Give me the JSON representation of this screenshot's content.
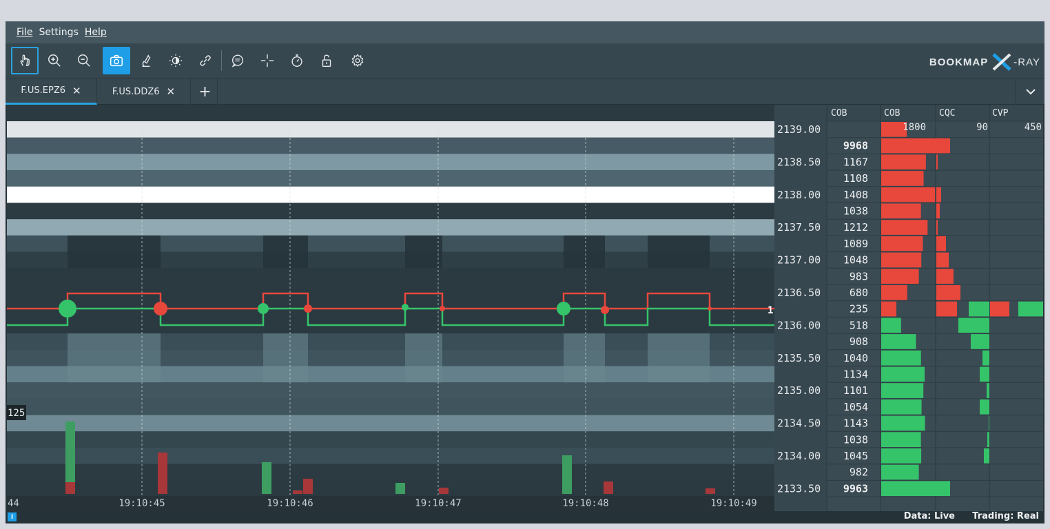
{
  "menu": {
    "file": "File",
    "settings": "Settings",
    "help": "Help"
  },
  "toolbar": {
    "icons": [
      "hand-icon",
      "zoom-in-icon",
      "zoom-out-icon",
      "camera-icon",
      "microscope-icon",
      "brightness-icon",
      "link-icon",
      "chat-icon",
      "crosshair-icon",
      "stopwatch-icon",
      "lock-icon",
      "gear-icon"
    ]
  },
  "logo": {
    "part1": "BOOKMAP",
    "part2": "X",
    "part3": "-RAY"
  },
  "tabs": [
    {
      "label": "F.US.EPZ6",
      "close": "✕"
    },
    {
      "label": "F.US.DDZ6",
      "close": "✕"
    }
  ],
  "tab_add": "+",
  "headers": {
    "cob1": "COB",
    "cob2": "COB",
    "cqc": "CQC",
    "cvp": "CVP"
  },
  "header_values": {
    "cob2": "1800",
    "cqc": "90",
    "cvp": "450"
  },
  "prices": [
    "2139.00",
    "2138.50",
    "2138.00",
    "2137.50",
    "2137.00",
    "2136.50",
    "2136.00",
    "2135.50",
    "2135.00",
    "2134.50",
    "2134.00",
    "2133.50"
  ],
  "cob_values": [
    "9968",
    "1167",
    "1108",
    "1408",
    "1038",
    "1212",
    "1089",
    "1048",
    "983",
    "680",
    "235",
    "518",
    "908",
    "1040",
    "1134",
    "1101",
    "1054",
    "1143",
    "1038",
    "1045",
    "982",
    "9963"
  ],
  "volume_label": "125",
  "last_marker": "1",
  "time_axis": {
    "left_cut": "44",
    "ticks": [
      "19:10:45",
      "19:10:46",
      "19:10:47",
      "19:10:48",
      "19:10:49"
    ]
  },
  "status": {
    "data": "Data: Live",
    "trading": "Trading: Real"
  },
  "colors": {
    "accent": "#1e9ee6",
    "ask": "#e8473c",
    "bid": "#35c46a",
    "background": "#253238"
  }
}
